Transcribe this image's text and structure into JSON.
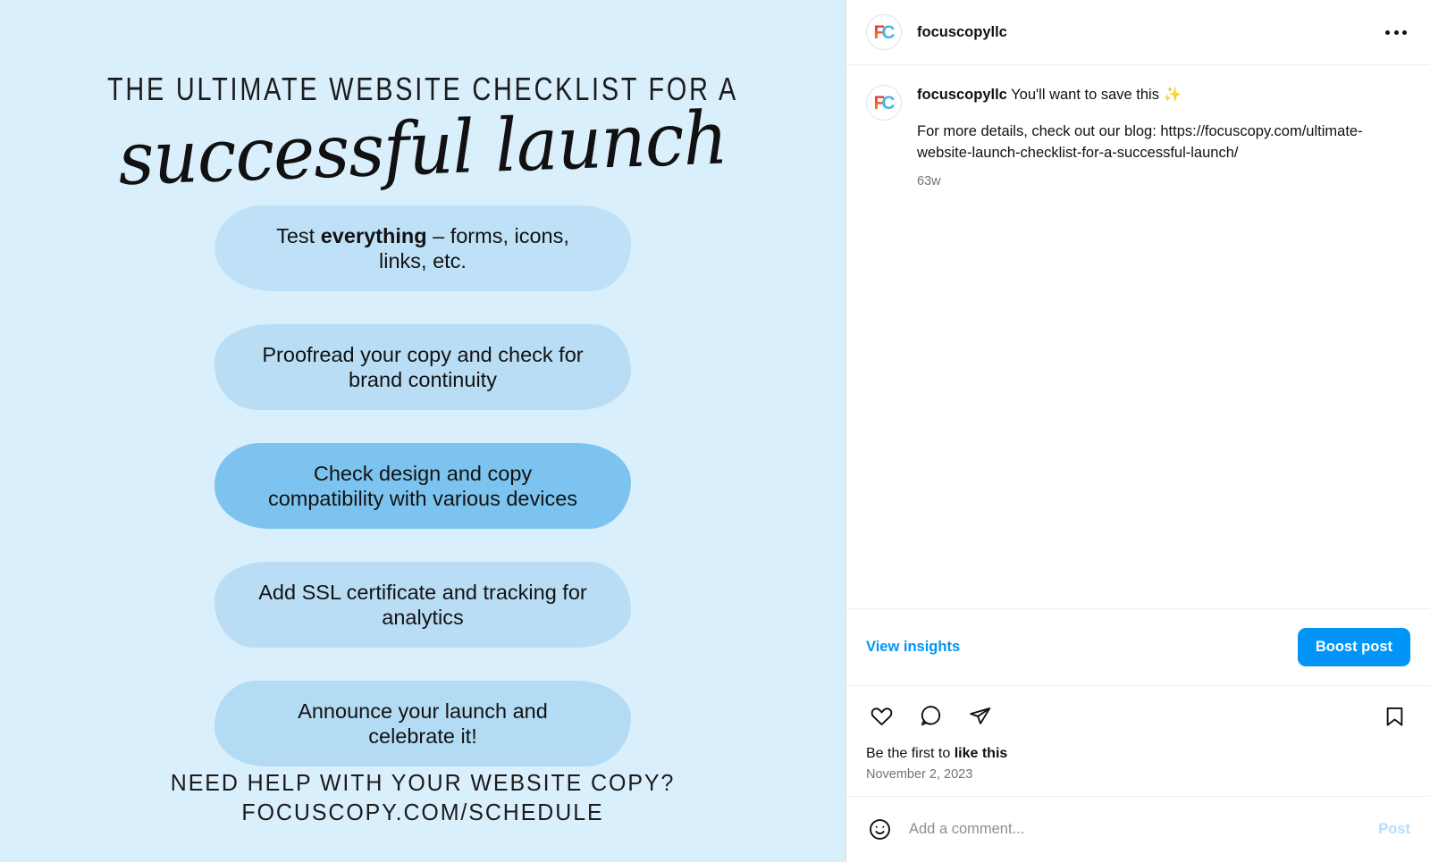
{
  "post_image": {
    "background_color": "#daeffc",
    "title_line1": "THE ULTIMATE WEBSITE CHECKLIST FOR A",
    "title_script": "successful launch",
    "checklist": [
      {
        "text_before": "Test ",
        "text_bold": "everything",
        "text_after": " – forms, icons, links, etc.",
        "highlight": false,
        "color": "#bfe1f7"
      },
      {
        "text_before": "Proofread your copy and check for brand continuity",
        "text_bold": "",
        "text_after": "",
        "highlight": false,
        "color": "#b9ddf5"
      },
      {
        "text_before": "Check design and copy compatibility with various devices",
        "text_bold": "",
        "text_after": "",
        "highlight": true,
        "color": "#7cc4ef"
      },
      {
        "text_before": "Add SSL certificate and tracking for analytics",
        "text_bold": "",
        "text_after": "",
        "highlight": false,
        "color": "#b9ddf5"
      },
      {
        "text_before": "Announce your launch and celebrate it!",
        "text_bold": "",
        "text_after": "",
        "highlight": false,
        "color": "#b3dbf4"
      }
    ],
    "footer_line1": "NEED HELP WITH YOUR WEBSITE COPY?",
    "footer_line2": "FOCUSCOPY.COM/SCHEDULE"
  },
  "panel": {
    "header": {
      "username": "focuscopyllc",
      "avatar_initials_f": "F",
      "avatar_initials_c": "C",
      "more_menu_label": "…"
    },
    "caption": {
      "username": "focuscopyllc",
      "text": " You'll want to save this ✨",
      "body": "For more details, check out our blog: https://focuscopy.com/ultimate-website-launch-checklist-for-a-successful-launch/",
      "time_ago": "63w"
    },
    "insights": {
      "view_insights_label": "View insights",
      "boost_label": "Boost post",
      "accent_color": "#0095f6"
    },
    "actions": {
      "like_icon": "heart-icon",
      "comment_icon": "comment-icon",
      "share_icon": "share-icon",
      "save_icon": "bookmark-icon",
      "likes_prefix": "Be the first to ",
      "likes_bold": "like this",
      "post_date": "November 2, 2023"
    },
    "comment_box": {
      "emoji_icon": "emoji-icon",
      "placeholder": "Add a comment...",
      "value": "",
      "post_label": "Post"
    }
  }
}
